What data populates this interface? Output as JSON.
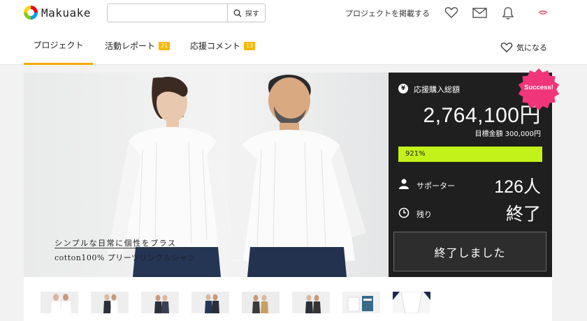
{
  "header": {
    "brand": "Makuake",
    "search_placeholder": "",
    "search_button": "探す",
    "post_project": "プロジェクトを掲載する"
  },
  "tabs": {
    "project": "プロジェクト",
    "report": "活動レポート",
    "report_count": "21",
    "comment": "応援コメント",
    "comment_count": "13",
    "favorite": "気になる"
  },
  "hero": {
    "catch_line_1": "シンプルな日常に個性をプラス",
    "catch_line_2": "cotton100% プリーツリンクルシャツ"
  },
  "stats": {
    "total_label": "応援購入総額",
    "total_amount": "2,764,100円",
    "goal": "目標金額 300,000円",
    "progress_text": "921%",
    "progress_percent": 921,
    "supporters_label": "サポーター",
    "supporters_value": "126人",
    "remaining_label": "残り",
    "remaining_value": "終了",
    "ended_button": "終了しました",
    "success_badge": "Success!"
  },
  "colors": {
    "accent": "#f5a800",
    "progress": "#c2f21a",
    "panel": "#1f1f1f",
    "success": "#f0357a"
  }
}
